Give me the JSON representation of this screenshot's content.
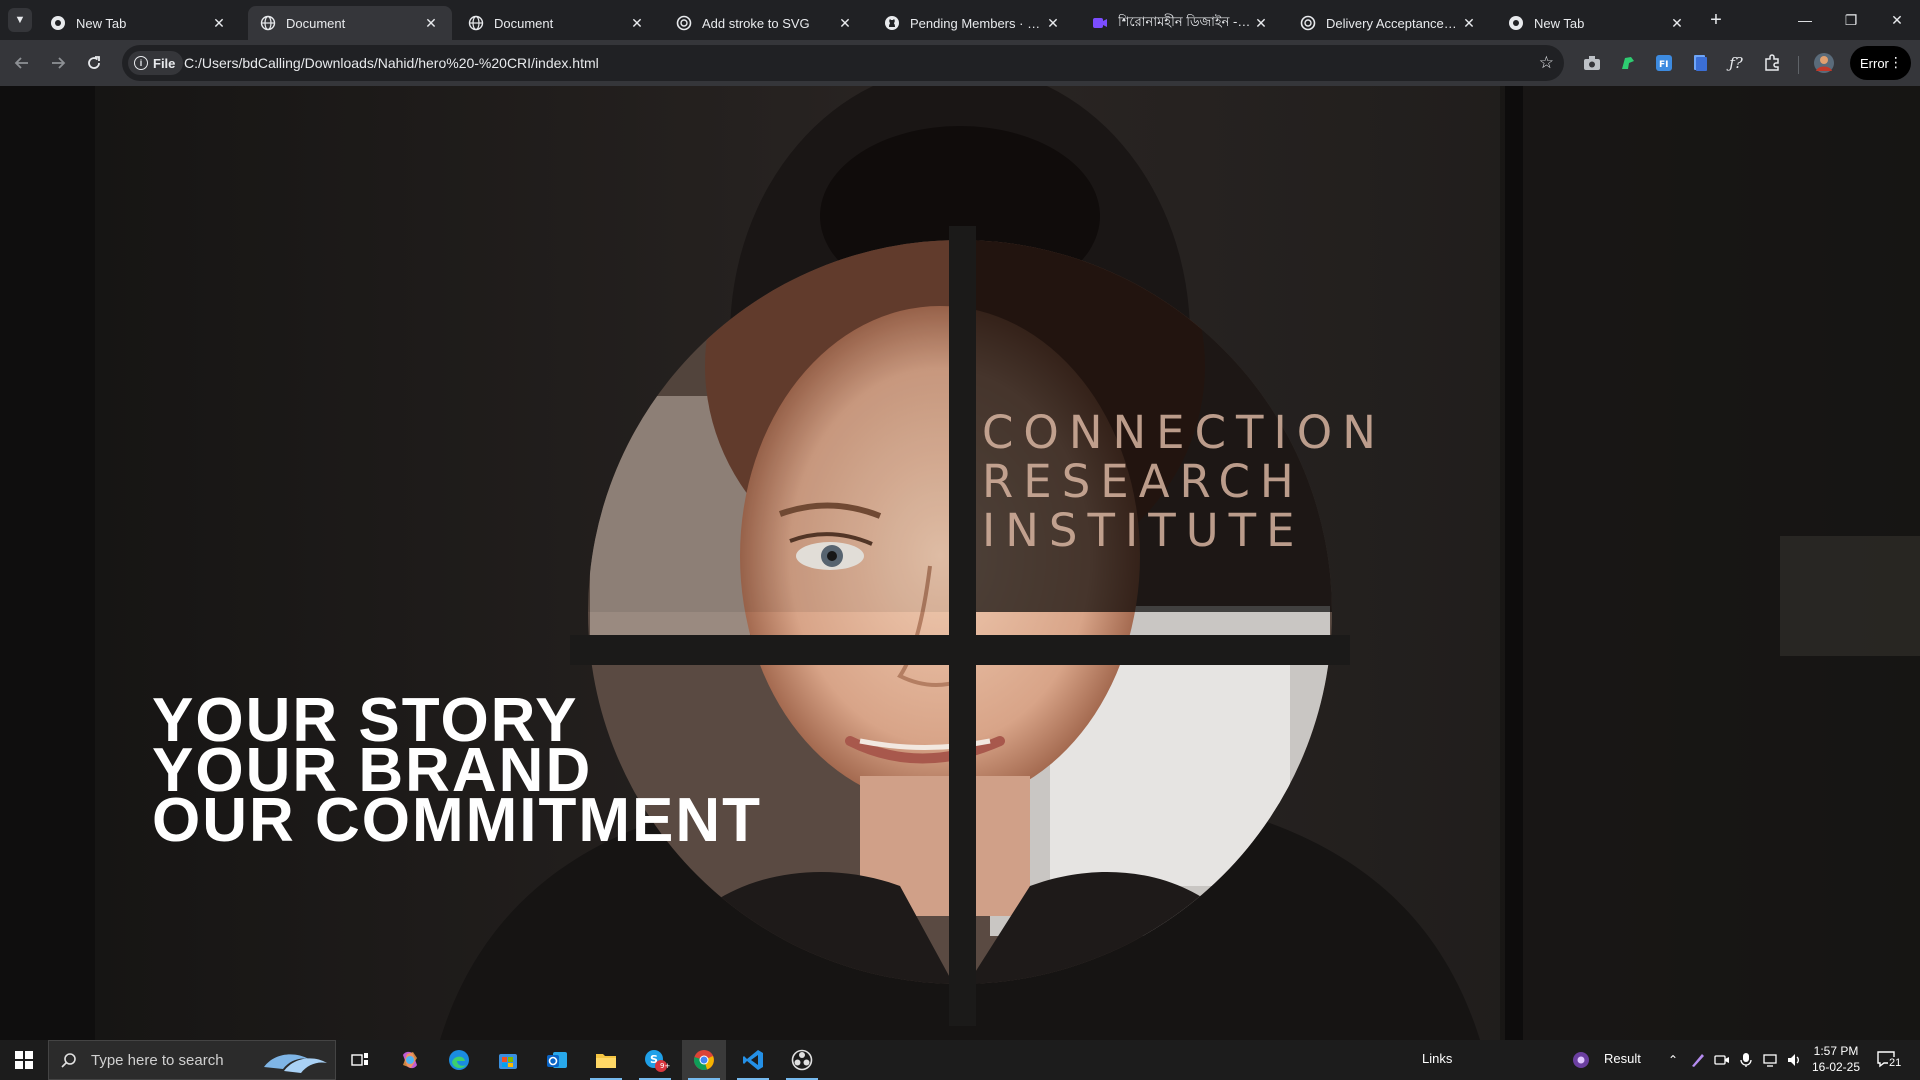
{
  "browser": {
    "tabs": [
      {
        "title": "New Tab",
        "icon": "chrome-icon",
        "active": false
      },
      {
        "title": "Document",
        "icon": "globe-icon",
        "active": true
      },
      {
        "title": "Document",
        "icon": "globe-icon",
        "active": false
      },
      {
        "title": "Add stroke to SVG",
        "icon": "openai-icon",
        "active": false
      },
      {
        "title": "Pending Members · People",
        "icon": "github-icon",
        "active": false
      },
      {
        "title": "শিরোনামহীন ডিজাইন - Ma",
        "icon": "canva-icon",
        "active": false
      },
      {
        "title": "Delivery Acceptance Requ",
        "icon": "openai-icon",
        "active": false
      },
      {
        "title": "New Tab",
        "icon": "chrome-icon",
        "active": false
      }
    ],
    "address": {
      "chip_label": "File",
      "url": "C:/Users/bdCalling/Downloads/Nahid/hero%20-%20CRI/index.html"
    },
    "profile_button": "Error"
  },
  "page": {
    "hero_lines": [
      "YOUR STORY",
      "YOUR BRAND",
      "OUR COMMITMENT"
    ],
    "brand_lines": [
      "CONNECTION",
      "RESEARCH",
      "INSTITUTE"
    ]
  },
  "taskbar": {
    "search_placeholder": "Type here to search",
    "links_label": "Links",
    "result_label": "Result",
    "time": "1:57 PM",
    "date": "16-02-25",
    "notification_count": "21",
    "skype_badge": "9+"
  },
  "colors": {
    "tabstrip": "#202124",
    "toolbar": "#35363a",
    "omnibox": "#202124",
    "taskbar": "#1c1c1c",
    "accent": "#76b9ed"
  }
}
